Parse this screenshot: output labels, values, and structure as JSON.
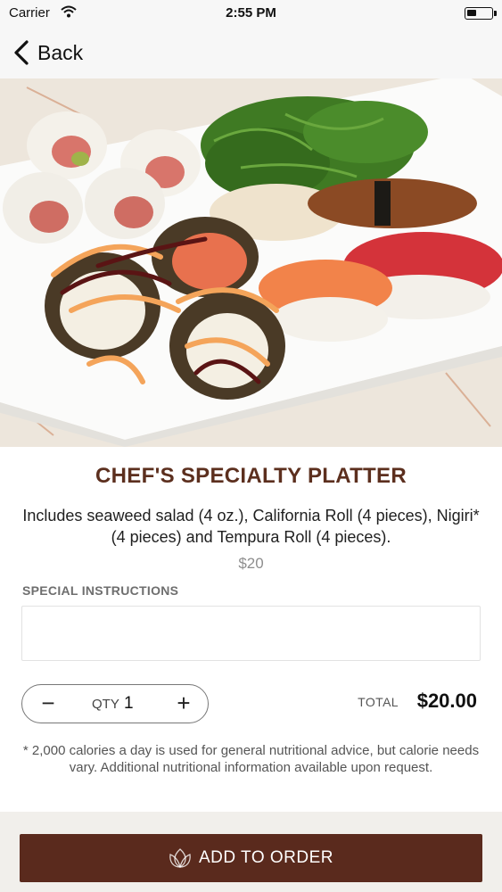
{
  "status_bar": {
    "carrier": "Carrier",
    "time": "2:55 PM"
  },
  "nav": {
    "back_label": "Back"
  },
  "hero": {
    "image_name": "sushi-platter-photo"
  },
  "item": {
    "title": "CHEF'S SPECIALTY PLATTER",
    "description": "Includes seaweed salad (4 oz.), California Roll (4 pieces), Nigiri* (4 pieces) and Tempura Roll (4 pieces).",
    "price": "$20"
  },
  "instructions": {
    "label": "SPECIAL INSTRUCTIONS",
    "value": "",
    "placeholder": ""
  },
  "quantity": {
    "minus": "−",
    "label": "QTY",
    "value": "1",
    "plus": "+"
  },
  "total": {
    "label": "TOTAL",
    "value": "$20.00"
  },
  "disclaimer": "* 2,000 calories a day is used for general nutritional advice, but calorie needs vary. Additional nutritional information available upon request.",
  "footer": {
    "add_label": "ADD TO ORDER"
  },
  "colors": {
    "brand": "#5a2a1d",
    "title": "#5c2f1e",
    "footer_bg": "#f1efeb"
  }
}
